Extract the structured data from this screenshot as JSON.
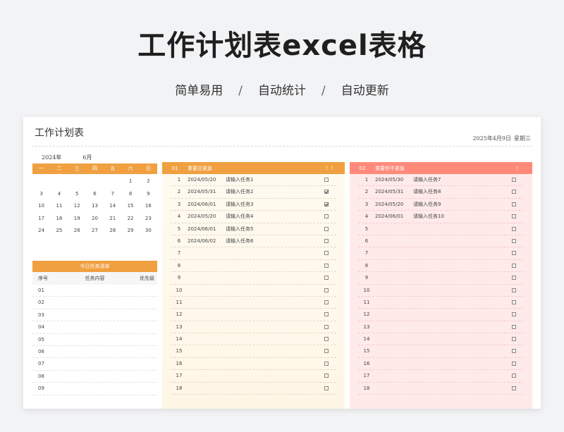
{
  "hero": {
    "title": "工作计划表excel表格",
    "subtitle": [
      "简单易用",
      "自动统计",
      "自动更新"
    ],
    "separator": "/"
  },
  "sheet": {
    "title": "工作计划表",
    "date": "2025年4月9日",
    "weekday": "星期三"
  },
  "calendar": {
    "year": "2024年",
    "month": "6月",
    "weekdays": [
      "一",
      "二",
      "三",
      "四",
      "五",
      "六",
      "日"
    ],
    "weeks": [
      [
        "",
        "",
        "",
        "",
        "",
        "1",
        "2"
      ],
      [
        "3",
        "4",
        "5",
        "6",
        "7",
        "8",
        "9"
      ],
      [
        "10",
        "11",
        "12",
        "13",
        "14",
        "15",
        "16"
      ],
      [
        "17",
        "18",
        "19",
        "20",
        "21",
        "22",
        "23"
      ],
      [
        "24",
        "25",
        "26",
        "27",
        "28",
        "29",
        "30"
      ]
    ]
  },
  "today": {
    "header": "今日任务清单",
    "columns": [
      "序号",
      "任务内容",
      "优先级"
    ],
    "rows": [
      "01",
      "02",
      "03",
      "04",
      "05",
      "06",
      "07",
      "08",
      "09"
    ]
  },
  "panels": [
    {
      "num": "01",
      "name": "重要且紧急",
      "mark": "！！",
      "rows": [
        {
          "n": "1",
          "date": "2024/05/20",
          "task": "请输入任务1",
          "done": false
        },
        {
          "n": "2",
          "date": "2024/05/31",
          "task": "请输入任务2",
          "done": true
        },
        {
          "n": "3",
          "date": "2024/06/01",
          "task": "请输入任务3",
          "done": true
        },
        {
          "n": "4",
          "date": "2024/05/20",
          "task": "请输入任务4",
          "done": false
        },
        {
          "n": "5",
          "date": "2024/06/01",
          "task": "请输入任务5",
          "done": false
        },
        {
          "n": "6",
          "date": "2024/06/02",
          "task": "请输入任务6",
          "done": false
        },
        {
          "n": "7",
          "date": "",
          "task": "",
          "done": false
        },
        {
          "n": "8",
          "date": "",
          "task": "",
          "done": false
        },
        {
          "n": "9",
          "date": "",
          "task": "",
          "done": false
        },
        {
          "n": "10",
          "date": "",
          "task": "",
          "done": false
        },
        {
          "n": "11",
          "date": "",
          "task": "",
          "done": false
        },
        {
          "n": "12",
          "date": "",
          "task": "",
          "done": false
        },
        {
          "n": "13",
          "date": "",
          "task": "",
          "done": false
        },
        {
          "n": "14",
          "date": "",
          "task": "",
          "done": false
        },
        {
          "n": "15",
          "date": "",
          "task": "",
          "done": false
        },
        {
          "n": "16",
          "date": "",
          "task": "",
          "done": false
        },
        {
          "n": "17",
          "date": "",
          "task": "",
          "done": false
        },
        {
          "n": "18",
          "date": "",
          "task": "",
          "done": false
        }
      ]
    },
    {
      "num": "02",
      "name": "重要但不紧急",
      "mark": "！",
      "rows": [
        {
          "n": "1",
          "date": "2024/05/30",
          "task": "请输入任务7",
          "done": false
        },
        {
          "n": "2",
          "date": "2024/05/31",
          "task": "请输入任务8",
          "done": false
        },
        {
          "n": "3",
          "date": "2024/05/20",
          "task": "请输入任务9",
          "done": false
        },
        {
          "n": "4",
          "date": "2024/06/01",
          "task": "请输入任务10",
          "done": false
        },
        {
          "n": "5",
          "date": "",
          "task": "",
          "done": false
        },
        {
          "n": "6",
          "date": "",
          "task": "",
          "done": false
        },
        {
          "n": "7",
          "date": "",
          "task": "",
          "done": false
        },
        {
          "n": "8",
          "date": "",
          "task": "",
          "done": false
        },
        {
          "n": "9",
          "date": "",
          "task": "",
          "done": false
        },
        {
          "n": "10",
          "date": "",
          "task": "",
          "done": false
        },
        {
          "n": "11",
          "date": "",
          "task": "",
          "done": false
        },
        {
          "n": "12",
          "date": "",
          "task": "",
          "done": false
        },
        {
          "n": "13",
          "date": "",
          "task": "",
          "done": false
        },
        {
          "n": "14",
          "date": "",
          "task": "",
          "done": false
        },
        {
          "n": "15",
          "date": "",
          "task": "",
          "done": false
        },
        {
          "n": "16",
          "date": "",
          "task": "",
          "done": false
        },
        {
          "n": "17",
          "date": "",
          "task": "",
          "done": false
        },
        {
          "n": "18",
          "date": "",
          "task": "",
          "done": false
        }
      ]
    }
  ]
}
